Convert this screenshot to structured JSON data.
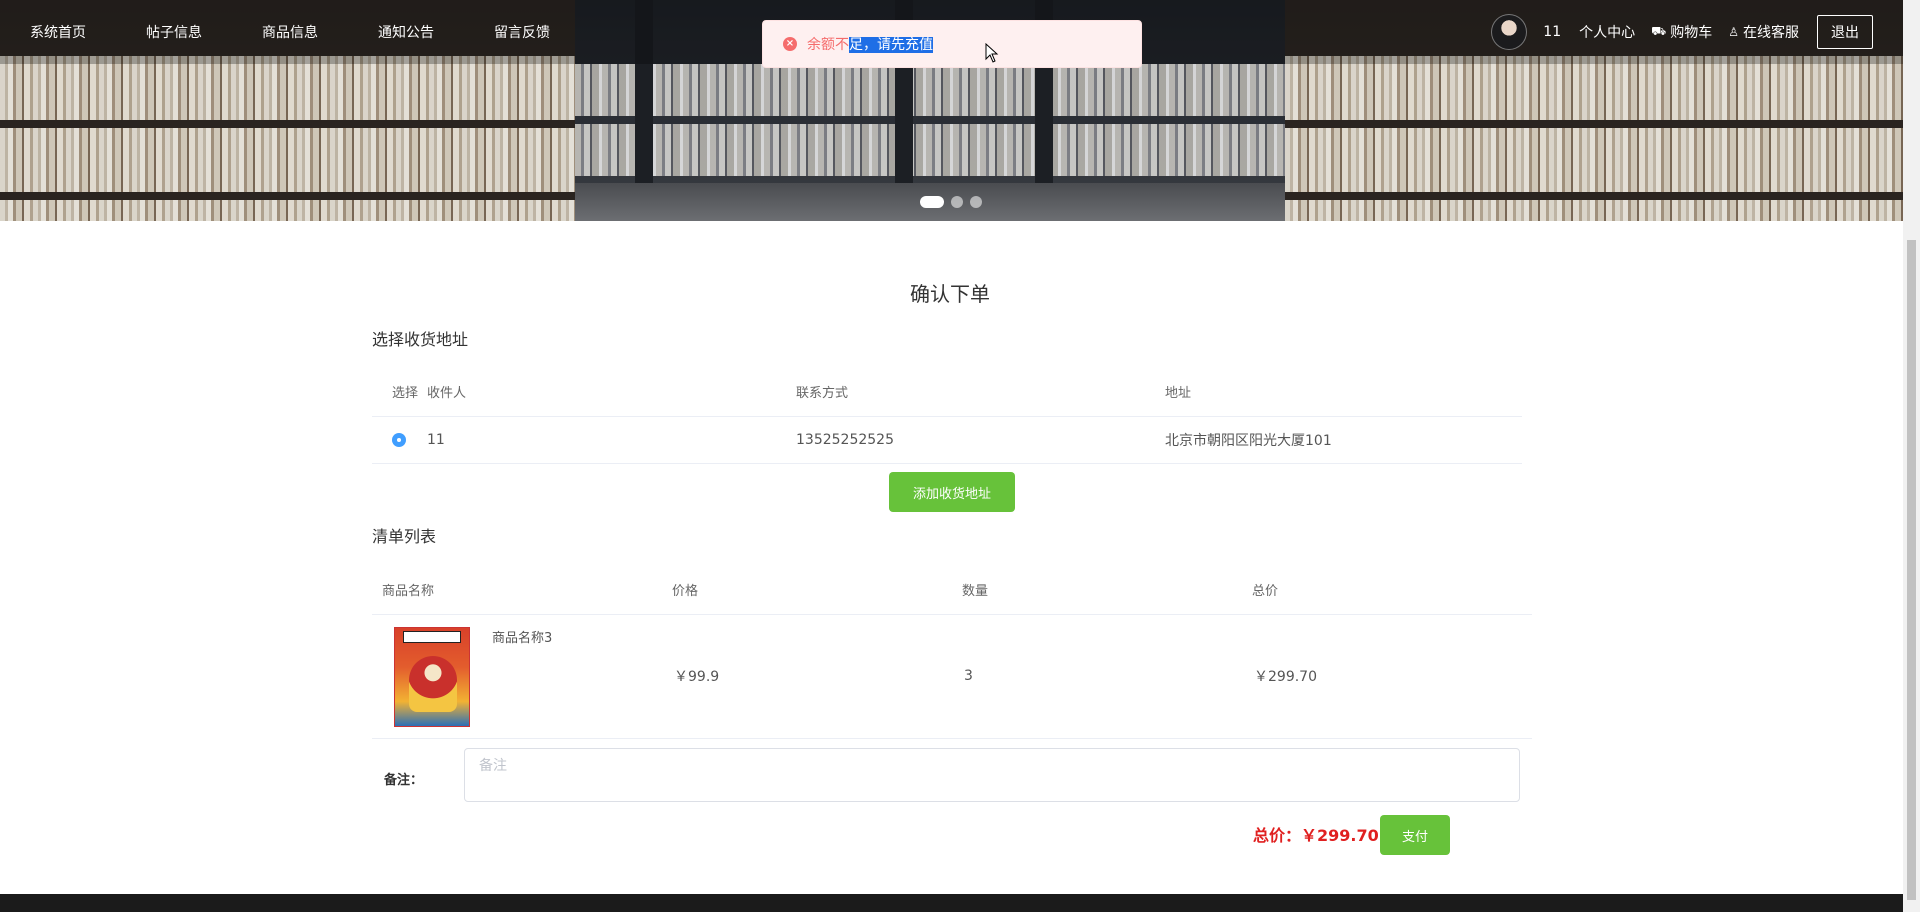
{
  "nav": {
    "items": [
      {
        "label": "系统首页"
      },
      {
        "label": "帖子信息"
      },
      {
        "label": "商品信息"
      },
      {
        "label": "通知公告"
      },
      {
        "label": "留言反馈"
      }
    ],
    "username": "11",
    "personal_center": "个人中心",
    "cart": "购物车",
    "support": "在线客服",
    "logout": "退出"
  },
  "toast": {
    "message_plain": "余额不",
    "message_selected": "足，请先充值",
    "type": "error",
    "color": "#f56c6c"
  },
  "carousel": {
    "slides": 3,
    "active": 1
  },
  "page": {
    "title": "确认下单"
  },
  "address_section": {
    "title": "选择收货地址",
    "columns": [
      "选择",
      "收件人",
      "联系方式",
      "地址"
    ],
    "rows": [
      {
        "selected": true,
        "receiver": "11",
        "phone": "13525252525",
        "address": "北京市朝阳区阳光大厦101"
      }
    ],
    "add_button": "添加收货地址"
  },
  "items_section": {
    "title": "清单列表",
    "columns": [
      "商品名称",
      "价格",
      "数量",
      "总价"
    ],
    "rows": [
      {
        "name": "商品名称3",
        "price": "￥99.9",
        "quantity": "3",
        "subtotal": "￥299.70"
      }
    ]
  },
  "remark": {
    "label": "备注：",
    "placeholder": "备注",
    "value": ""
  },
  "summary": {
    "total_label": "总价：",
    "total_value": "￥299.70",
    "pay_button": "支付"
  },
  "colors": {
    "accent_green": "#67c23a",
    "error_red": "#f56c6c",
    "total_red": "#e02020",
    "radio_blue": "#409eff"
  }
}
